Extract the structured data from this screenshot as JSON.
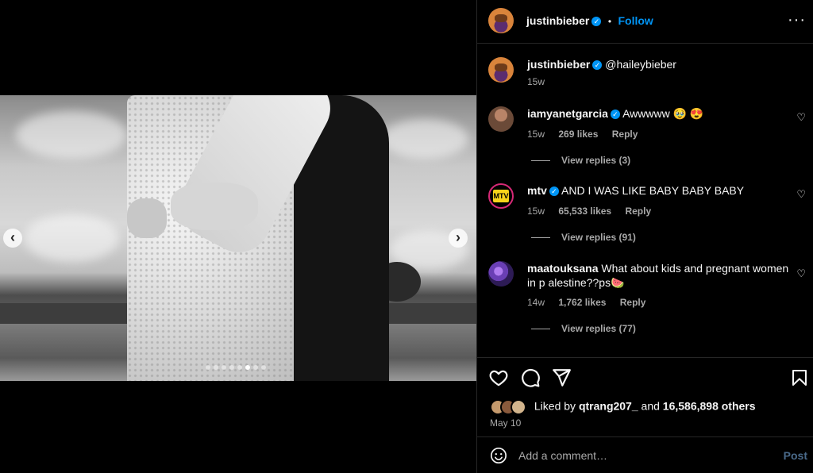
{
  "post": {
    "author": "justinbieber",
    "follow_label": "Follow",
    "separator": "•",
    "more_label": "···",
    "caption_mention": "@haileybieber",
    "caption_time": "15w",
    "media": {
      "slide_count": 8,
      "active_slide": 6
    },
    "nav_prev": "‹",
    "nav_next": "›"
  },
  "comments": [
    {
      "user": "iamyanetgarcia",
      "text": "Awwwww 🥹 😍",
      "time": "15w",
      "likes": "269 likes",
      "reply": "Reply",
      "view_replies": "View replies (3)"
    },
    {
      "user": "mtv",
      "text": "AND I WAS LIKE BABY BABY BABY",
      "time": "15w",
      "likes": "65,533 likes",
      "reply": "Reply",
      "view_replies": "View replies (91)"
    },
    {
      "user": "maatouksana",
      "text": "What about kids and pregnant women in p alestine??ps🍉",
      "time": "14w",
      "likes": "1,762 likes",
      "reply": "Reply",
      "view_replies": "View replies (77)"
    }
  ],
  "footer": {
    "liked_by_prefix": "Liked by",
    "liked_by_user": "qtrang207_",
    "liked_by_and": "and",
    "liked_by_others": "16,586,898 others",
    "date": "May 10",
    "add_comment_placeholder": "Add a comment…",
    "post_label": "Post"
  },
  "colors": {
    "accent": "#0095f6",
    "background": "#000000",
    "secondary_text": "#a8a8a8"
  },
  "icons": [
    "heart-icon",
    "comment-icon",
    "share-icon",
    "bookmark-icon",
    "emoji-icon",
    "verified-icon",
    "more-icon"
  ]
}
